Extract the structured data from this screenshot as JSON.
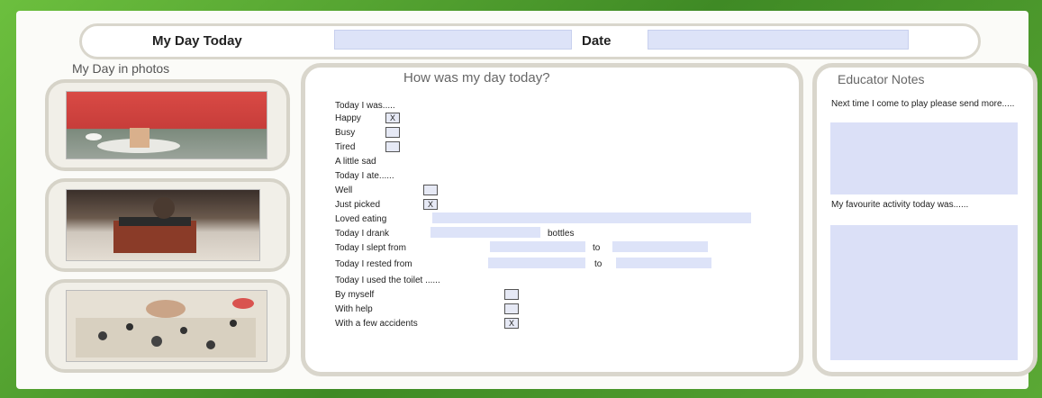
{
  "header": {
    "title": "My Day Today",
    "date_label": "Date"
  },
  "photos": {
    "heading": "My Day in photos"
  },
  "main": {
    "heading": "How was my day today?",
    "today_i_was": "Today I was.....",
    "moods": [
      {
        "label": "Happy",
        "checked": true
      },
      {
        "label": "Busy",
        "checked": false
      },
      {
        "label": "Tired",
        "checked": false
      },
      {
        "label": "A little sad",
        "checked": false
      }
    ],
    "today_i_ate": "Today I ate......",
    "ate_options": [
      {
        "label": "Well",
        "checked": false
      },
      {
        "label": "Just picked",
        "checked": true
      }
    ],
    "loved_eating": "Loved eating",
    "drank_label": "Today I drank",
    "drank_suffix": "bottles",
    "slept_label": "Today I slept from",
    "slept_to": "to",
    "rested_label": "Today I rested from",
    "rested_to": "to",
    "toilet_label": "Today I used the toilet ......",
    "toilet_options": [
      {
        "label": "By myself",
        "checked": false
      },
      {
        "label": "With help",
        "checked": false
      },
      {
        "label": "With a few accidents",
        "checked": true
      }
    ],
    "check_mark": "X"
  },
  "notes": {
    "heading": "Educator Notes",
    "next_time": "Next time I come to play please send more.....",
    "favourite": "My favourite activity today was......"
  },
  "colors": {
    "field": "#dde3f8",
    "border": "#d6d3c8",
    "frame": "#4e9a2f"
  }
}
